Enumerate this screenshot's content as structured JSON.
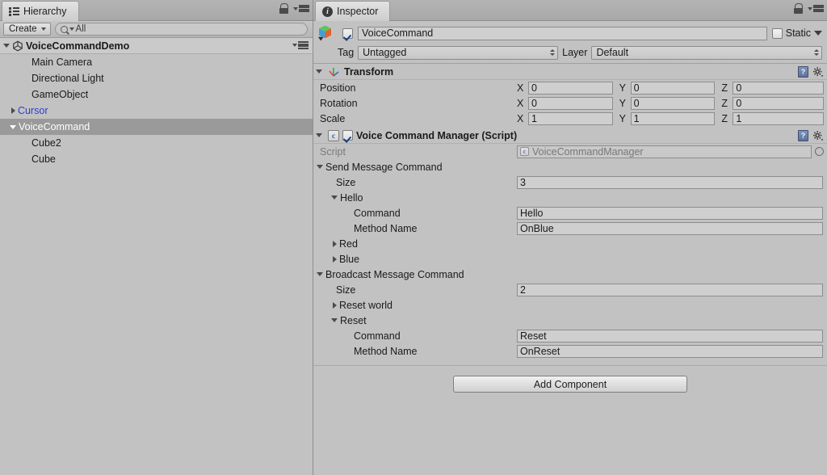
{
  "hierarchy": {
    "tab": {
      "label": "Hierarchy",
      "icon": "hierarchy-list-icon"
    },
    "tools": {
      "lock": "lock-icon",
      "menu": "panel-menu-icon"
    },
    "toolbar": {
      "create_label": "Create",
      "search_value": "All",
      "search_placeholder": "All",
      "search_icon": "search-icon"
    },
    "scene": {
      "name": "VoiceCommandDemo",
      "expanded": true,
      "icon": "unity-scene-icon"
    },
    "items": [
      {
        "label": "Main Camera",
        "indent": 2,
        "arrow": "none",
        "selected": false,
        "prefab": false
      },
      {
        "label": "Directional Light",
        "indent": 2,
        "arrow": "none",
        "selected": false,
        "prefab": false
      },
      {
        "label": "GameObject",
        "indent": 2,
        "arrow": "none",
        "selected": false,
        "prefab": false
      },
      {
        "label": "Cursor",
        "indent": 1,
        "arrow": "right",
        "selected": false,
        "prefab": true
      },
      {
        "label": "VoiceCommand",
        "indent": 1,
        "arrow": "down",
        "selected": true,
        "prefab": false
      },
      {
        "label": "Cube2",
        "indent": 2,
        "arrow": "none",
        "selected": false,
        "prefab": false
      },
      {
        "label": "Cube",
        "indent": 2,
        "arrow": "none",
        "selected": false,
        "prefab": false
      }
    ]
  },
  "inspector": {
    "tab": {
      "label": "Inspector",
      "icon": "info-icon"
    },
    "tools": {
      "lock": "lock-icon",
      "menu": "panel-menu-icon"
    },
    "header": {
      "object_icon": "gameobject-cube-icon",
      "enabled": true,
      "name": "VoiceCommand",
      "static_label": "Static",
      "static_checked": false,
      "tag_label": "Tag",
      "tag_value": "Untagged",
      "layer_label": "Layer",
      "layer_value": "Default"
    },
    "transform": {
      "title": "Transform",
      "icon": "transform-axis-icon",
      "expanded": true,
      "help_icon": "help-book-icon",
      "gear_icon": "gear-icon",
      "rows": [
        {
          "label": "Position",
          "x": "0",
          "y": "0",
          "z": "0"
        },
        {
          "label": "Rotation",
          "x": "0",
          "y": "0",
          "z": "0"
        },
        {
          "label": "Scale",
          "x": "1",
          "y": "1",
          "z": "1"
        }
      ],
      "axis_labels": [
        "X",
        "Y",
        "Z"
      ]
    },
    "script_component": {
      "title": "Voice Command Manager (Script)",
      "icon": "csharp-script-icon",
      "enabled": true,
      "expanded": true,
      "help_icon": "help-book-icon",
      "gear_icon": "gear-icon",
      "script_field": {
        "label": "Script",
        "value": "VoiceCommandManager",
        "icon": "csharp-script-icon"
      },
      "send_message_command": {
        "label": "Send Message Command",
        "expanded": true,
        "size_label": "Size",
        "size_value": "3",
        "entries": [
          {
            "label": "Hello",
            "expanded": true,
            "fields": [
              {
                "label": "Command",
                "value": "Hello"
              },
              {
                "label": "Method Name",
                "value": "OnBlue"
              }
            ]
          },
          {
            "label": "Red",
            "expanded": false,
            "fields": []
          },
          {
            "label": "Blue",
            "expanded": false,
            "fields": []
          }
        ]
      },
      "broadcast_message_command": {
        "label": "Broadcast Message Command",
        "expanded": true,
        "size_label": "Size",
        "size_value": "2",
        "entries": [
          {
            "label": "Reset world",
            "expanded": false,
            "fields": []
          },
          {
            "label": "Reset",
            "expanded": true,
            "fields": [
              {
                "label": "Command",
                "value": "Reset"
              },
              {
                "label": "Method Name",
                "value": "OnReset"
              }
            ]
          }
        ]
      }
    },
    "add_component_label": "Add Component"
  },
  "colors": {
    "panel_bg": "#c2c2c2",
    "field_bg": "#cfcfcf",
    "selection": "#9a9a9a",
    "prefab_blue": "#2a3fd4",
    "scene_row": "#cacaca"
  }
}
